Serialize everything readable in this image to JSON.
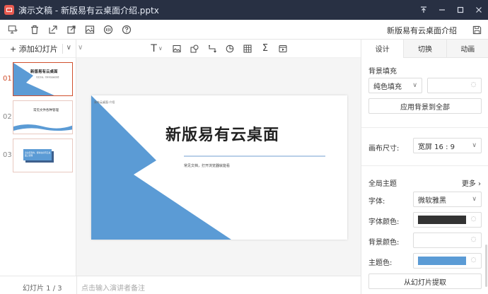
{
  "window": {
    "title": "演示文稿 - 新版易有云桌面介绍.pptx",
    "controls": [
      "pin-icon",
      "minimize-icon",
      "maximize-icon",
      "close-icon"
    ]
  },
  "toolbar": {
    "icons": [
      "present-icon",
      "trash-icon",
      "export-icon",
      "share-icon",
      "image-icon",
      "theme-icon",
      "help-icon"
    ],
    "filename": "新版易有云桌面介绍",
    "save_icon": "save-icon"
  },
  "slides_panel": {
    "add_slide_label": "+ 添加幻灯片",
    "thumbnails": [
      {
        "number": "01",
        "title": "新版易有云桌面",
        "subtitle": "常见文档，打开浏览器就能看"
      },
      {
        "number": "02",
        "title": "常见文件各种管理"
      },
      {
        "number": "03",
        "title": "身边见到的，都将在易有云桌面上管理"
      }
    ]
  },
  "editor_toolbar": {
    "icons": [
      "text-icon",
      "image-icon",
      "shape-icon",
      "connector-icon",
      "chart-icon",
      "table-icon",
      "formula-icon",
      "media-icon"
    ]
  },
  "slide": {
    "small_text": "易有云桌面·介绍",
    "title": "新版易有云桌面",
    "subtitle": "常见文档，打开浏览器就能看",
    "accent_color": "#5b9bd5"
  },
  "status": {
    "slide_count": "幻灯片 1 / 3",
    "notes_placeholder": "点击输入演讲者备注"
  },
  "right_panel": {
    "tabs": [
      "设计",
      "切换",
      "动画"
    ],
    "active_tab": "设计",
    "background_fill_label": "背景填充",
    "fill_type": "纯色填充",
    "apply_bg_all": "应用背景到全部",
    "canvas_size_label": "画布尺寸:",
    "canvas_size_value": "宽屏 16 : 9",
    "global_theme_label": "全局主题",
    "more_label": "更多",
    "font_label": "字体:",
    "font_value": "微软雅黑",
    "font_color_label": "字体颜色:",
    "font_color": "#333333",
    "bg_color_label": "背景颜色:",
    "bg_color": "#ffffff",
    "theme_color_label": "主题色:",
    "theme_color": "#5b9bd5",
    "extract_button": "从幻灯片提取"
  }
}
